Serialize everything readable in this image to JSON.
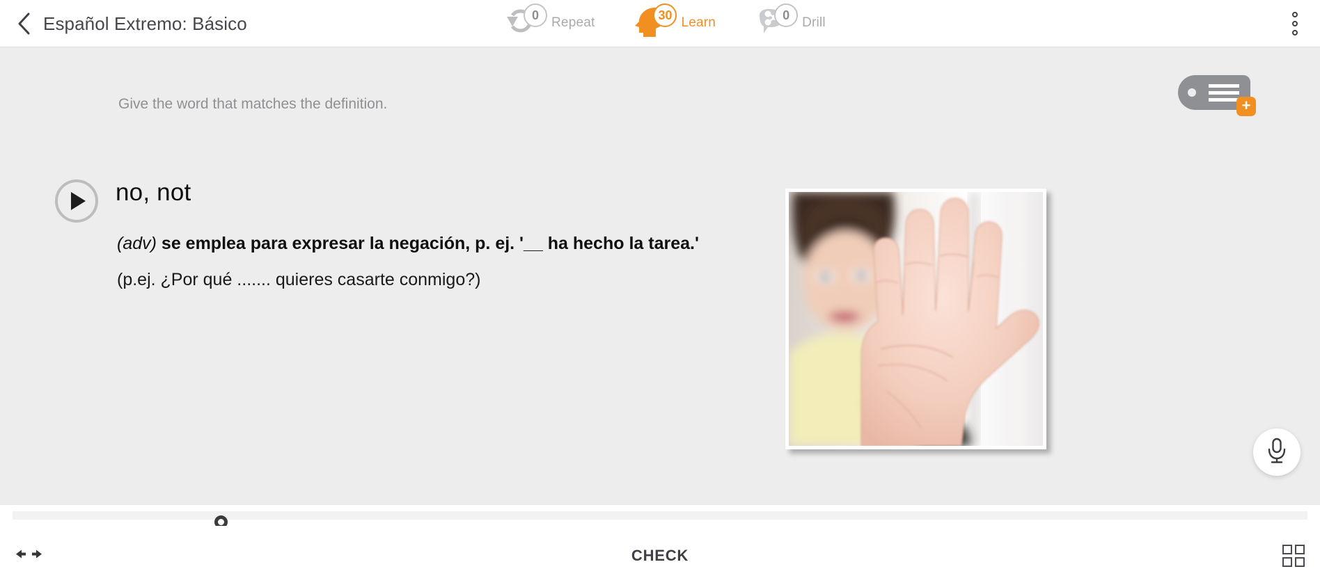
{
  "header": {
    "back_icon": "chevron-left-icon",
    "course_title": "Español Extremo: Básico",
    "menu_icon": "kebab-menu-icon",
    "modes": [
      {
        "icon": "repeat-icon",
        "count": "0",
        "label": "Repeat",
        "active": false
      },
      {
        "icon": "learn-head-icon",
        "count": "30",
        "label": "Learn",
        "active": true
      },
      {
        "icon": "drill-brain-icon",
        "count": "0",
        "label": "Drill",
        "active": false
      }
    ]
  },
  "exercise": {
    "prompt": "Give the word that matches the definition.",
    "play_icon": "play-audio-icon",
    "headword": "no, not",
    "definition_pos": "(adv)",
    "definition_body": "se emplea para expresar la negación, p. ej. '__ ha hecho la tarea.'",
    "example": "(p.ej. ¿Por qué ....... quieres casarte conmigo?)",
    "image_alt": "woman holding palm up in a stop gesture"
  },
  "tag_widget": {
    "icon": "tag-label-icon",
    "add_badge": "+"
  },
  "mic": {
    "icon": "microphone-icon"
  },
  "bottom": {
    "prev_icon": "arrow-left-icon",
    "next_icon": "arrow-right-icon",
    "check_label": "CHECK",
    "grid_icon": "grid-view-icon"
  },
  "colors": {
    "accent": "#f28f21",
    "muted": "#a8aaad",
    "text": "#3f4045",
    "canvas": "#ededed"
  }
}
